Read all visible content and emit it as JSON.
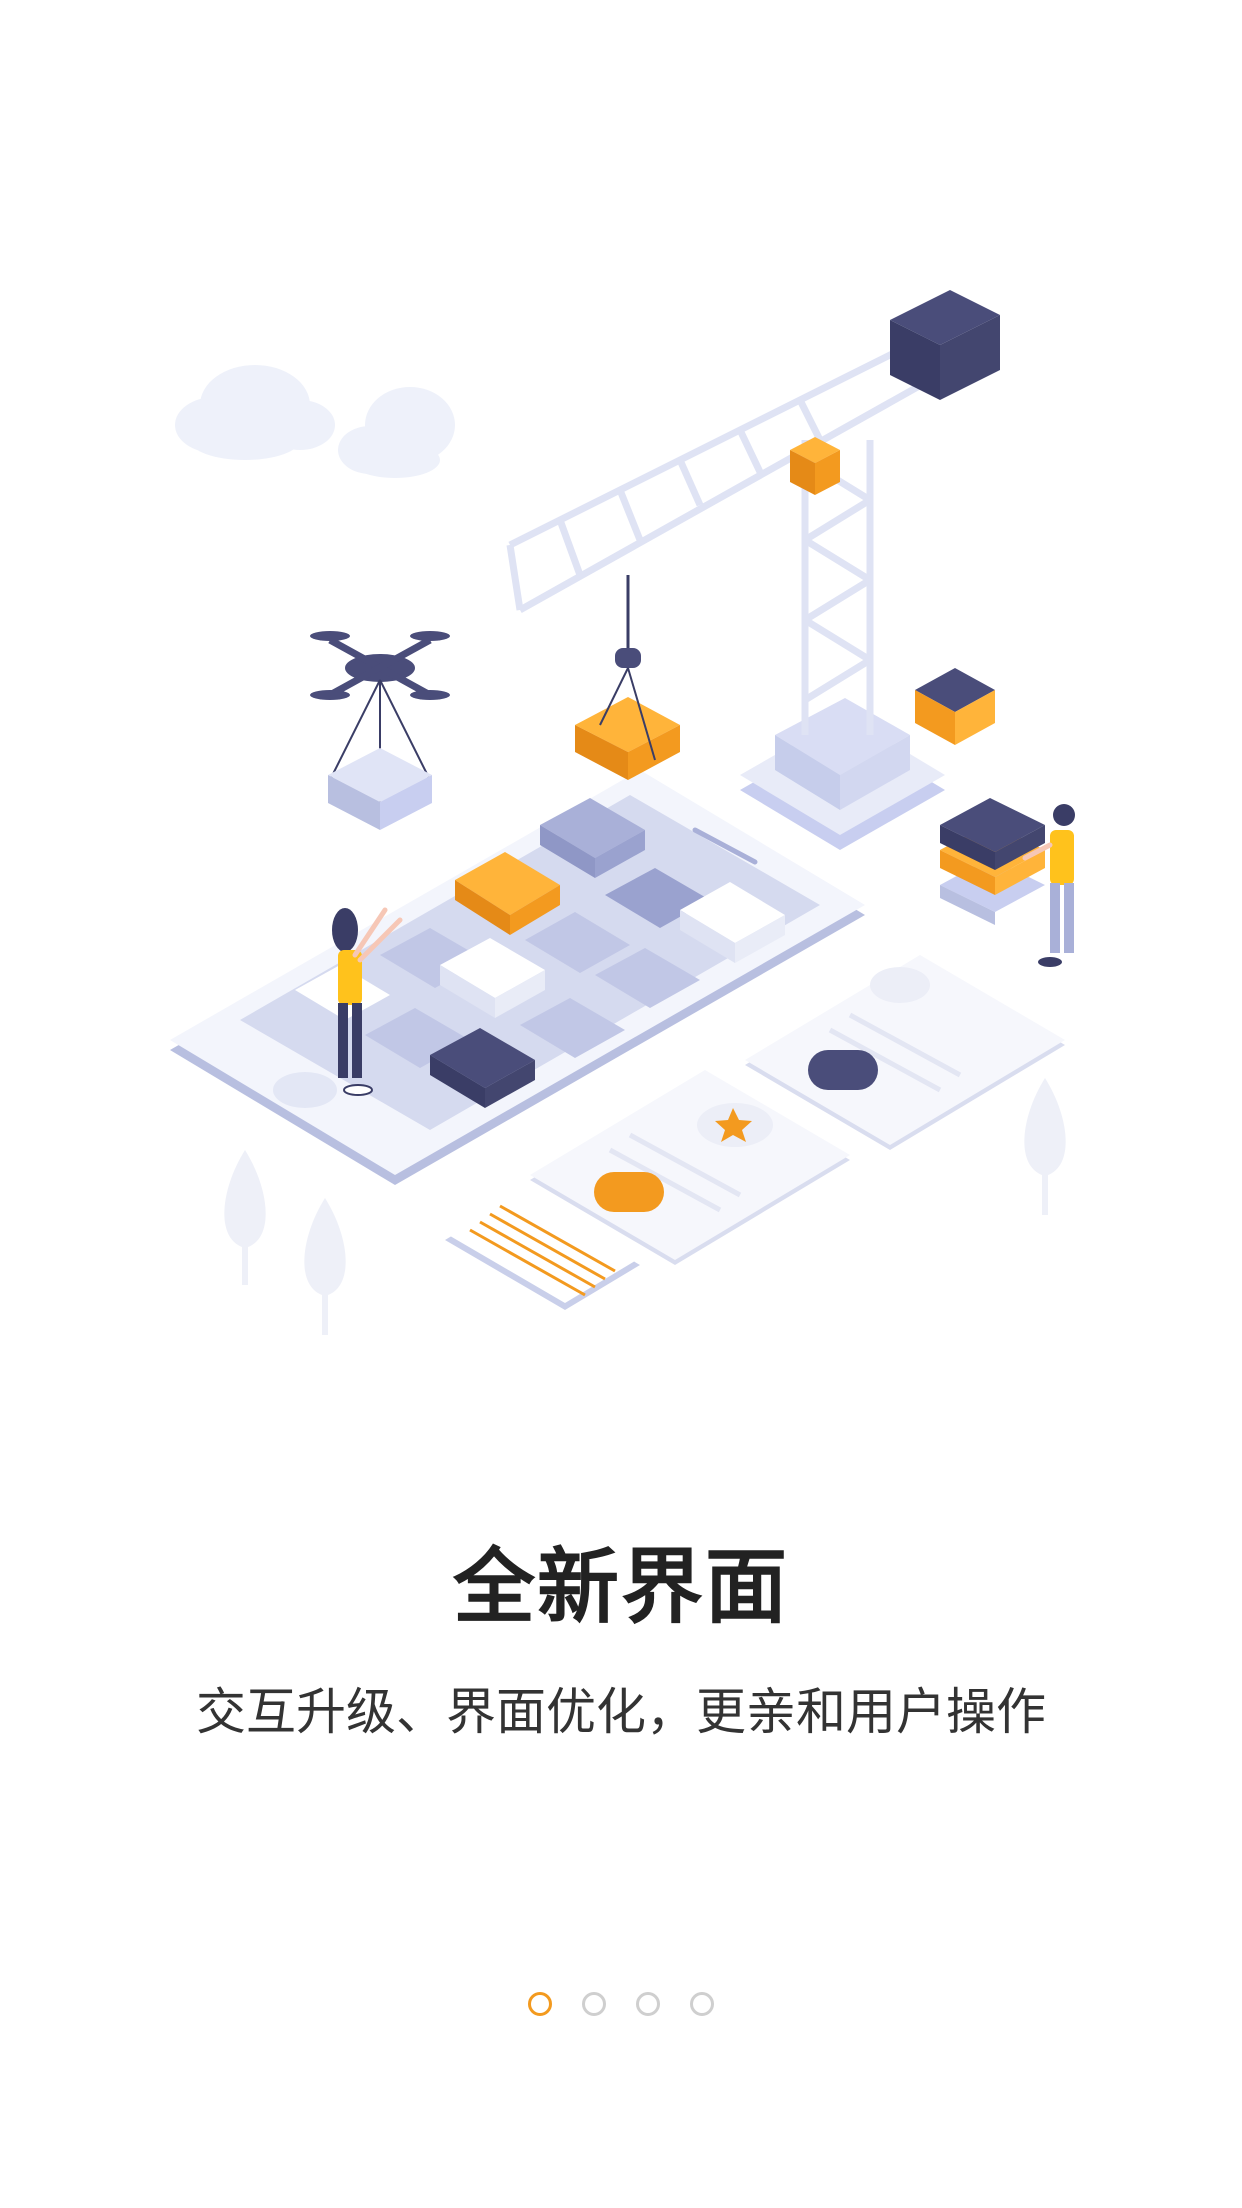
{
  "onboarding": {
    "title": "全新界面",
    "subtitle": "交互升级、界面优化，更亲和用户操作",
    "pages": [
      {
        "active": true
      },
      {
        "active": false
      },
      {
        "active": false
      },
      {
        "active": false
      }
    ]
  },
  "colors": {
    "accent": "#f39a1f",
    "navy": "#4a4d7a",
    "lavender": "#a9b0d8",
    "pale": "#e8ebf8",
    "inactive_dot": "#cfcfcf"
  },
  "illustration": {
    "icons": [
      "cloud-icon",
      "drone-icon",
      "crane-icon",
      "phone-icon",
      "person-icon",
      "tree-icon",
      "star-icon"
    ]
  }
}
